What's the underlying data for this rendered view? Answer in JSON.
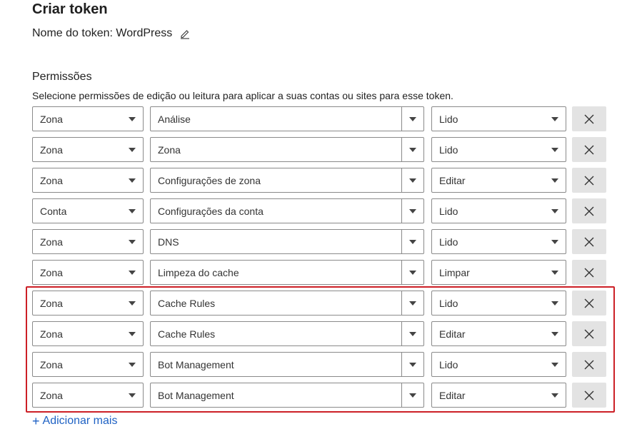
{
  "header": {
    "title": "Criar token",
    "token_name_label": "Nome do token: WordPress"
  },
  "permissions": {
    "title": "Permissões",
    "description": "Selecione permissões de edição ou leitura para aplicar a suas contas ou sites para esse token.",
    "rows": [
      {
        "scope": "Zona",
        "permission": "Análise",
        "level": "Lido"
      },
      {
        "scope": "Zona",
        "permission": "Zona",
        "level": "Lido"
      },
      {
        "scope": "Zona",
        "permission": "Configurações de zona",
        "level": "Editar"
      },
      {
        "scope": "Conta",
        "permission": "Configurações da conta",
        "level": "Lido"
      },
      {
        "scope": "Zona",
        "permission": "DNS",
        "level": "Lido"
      },
      {
        "scope": "Zona",
        "permission": "Limpeza do cache",
        "level": "Limpar"
      },
      {
        "scope": "Zona",
        "permission": "Cache Rules",
        "level": "Lido"
      },
      {
        "scope": "Zona",
        "permission": "Cache Rules",
        "level": "Editar"
      },
      {
        "scope": "Zona",
        "permission": "Bot Management",
        "level": "Lido"
      },
      {
        "scope": "Zona",
        "permission": "Bot Management",
        "level": "Editar"
      }
    ],
    "add_more_label": "Adicionar mais"
  },
  "icons": {
    "edit": "pencil-icon",
    "remove": "close-icon",
    "dropdown": "caret-down-icon",
    "add": "plus-icon"
  },
  "colors": {
    "link": "#1f62c4",
    "highlight_border": "#cc1f26",
    "remove_button_bg": "#e3e3e3"
  }
}
